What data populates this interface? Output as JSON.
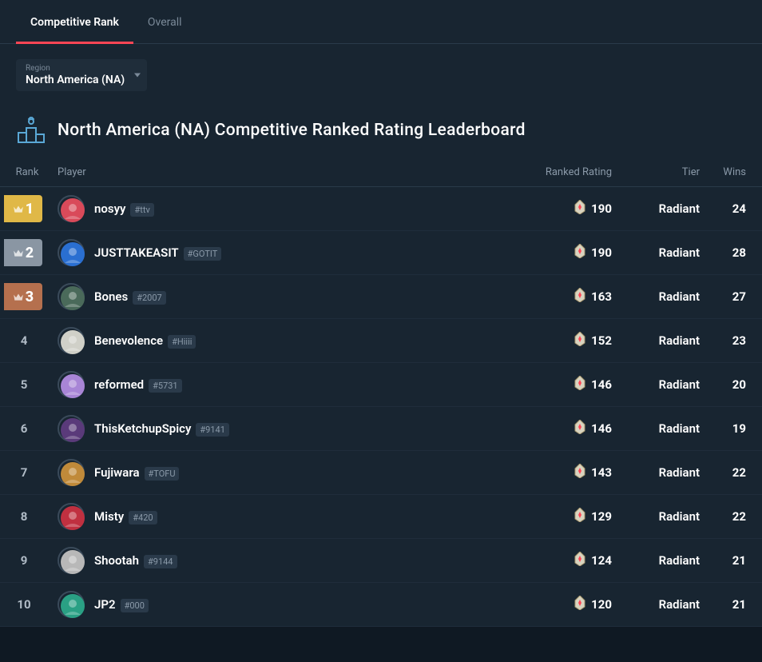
{
  "tabs": [
    {
      "label": "Competitive Rank",
      "active": true
    },
    {
      "label": "Overall",
      "active": false
    }
  ],
  "region": {
    "label": "Region",
    "value": "North America (NA)"
  },
  "title": "North America (NA) Competitive Ranked Rating Leaderboard",
  "columns": {
    "rank": "Rank",
    "player": "Player",
    "rating": "Ranked Rating",
    "tier": "Tier",
    "wins": "Wins"
  },
  "rows": [
    {
      "rank": 1,
      "name": "nosyy",
      "tag": "#ttv",
      "rating": 190,
      "tier": "Radiant",
      "wins": 24,
      "avatar": "#d94a5a"
    },
    {
      "rank": 2,
      "name": "JUSTTAKEASIT",
      "tag": "#GOTIT",
      "rating": 190,
      "tier": "Radiant",
      "wins": 28,
      "avatar": "#2a6fd1"
    },
    {
      "rank": 3,
      "name": "Bones",
      "tag": "#2007",
      "rating": 163,
      "tier": "Radiant",
      "wins": 27,
      "avatar": "#4a6a5a"
    },
    {
      "rank": 4,
      "name": "Benevolence",
      "tag": "#Hiiii",
      "rating": 152,
      "tier": "Radiant",
      "wins": 23,
      "avatar": "#d0d0c8"
    },
    {
      "rank": 5,
      "name": "reformed",
      "tag": "#5731",
      "rating": 146,
      "tier": "Radiant",
      "wins": 20,
      "avatar": "#a885d6"
    },
    {
      "rank": 6,
      "name": "ThisKetchupSpicy",
      "tag": "#9141",
      "rating": 146,
      "tier": "Radiant",
      "wins": 19,
      "avatar": "#5a3a7a"
    },
    {
      "rank": 7,
      "name": "Fujiwara",
      "tag": "#TOFU",
      "rating": 143,
      "tier": "Radiant",
      "wins": 22,
      "avatar": "#c08a3a"
    },
    {
      "rank": 8,
      "name": "Misty",
      "tag": "#420",
      "rating": 129,
      "tier": "Radiant",
      "wins": 22,
      "avatar": "#c03040"
    },
    {
      "rank": 9,
      "name": "Shootah",
      "tag": "#9144",
      "rating": 124,
      "tier": "Radiant",
      "wins": 21,
      "avatar": "#b8b8b8"
    },
    {
      "rank": 10,
      "name": "JP2",
      "tag": "#000",
      "rating": 120,
      "tier": "Radiant",
      "wins": 21,
      "avatar": "#2aa084"
    }
  ]
}
